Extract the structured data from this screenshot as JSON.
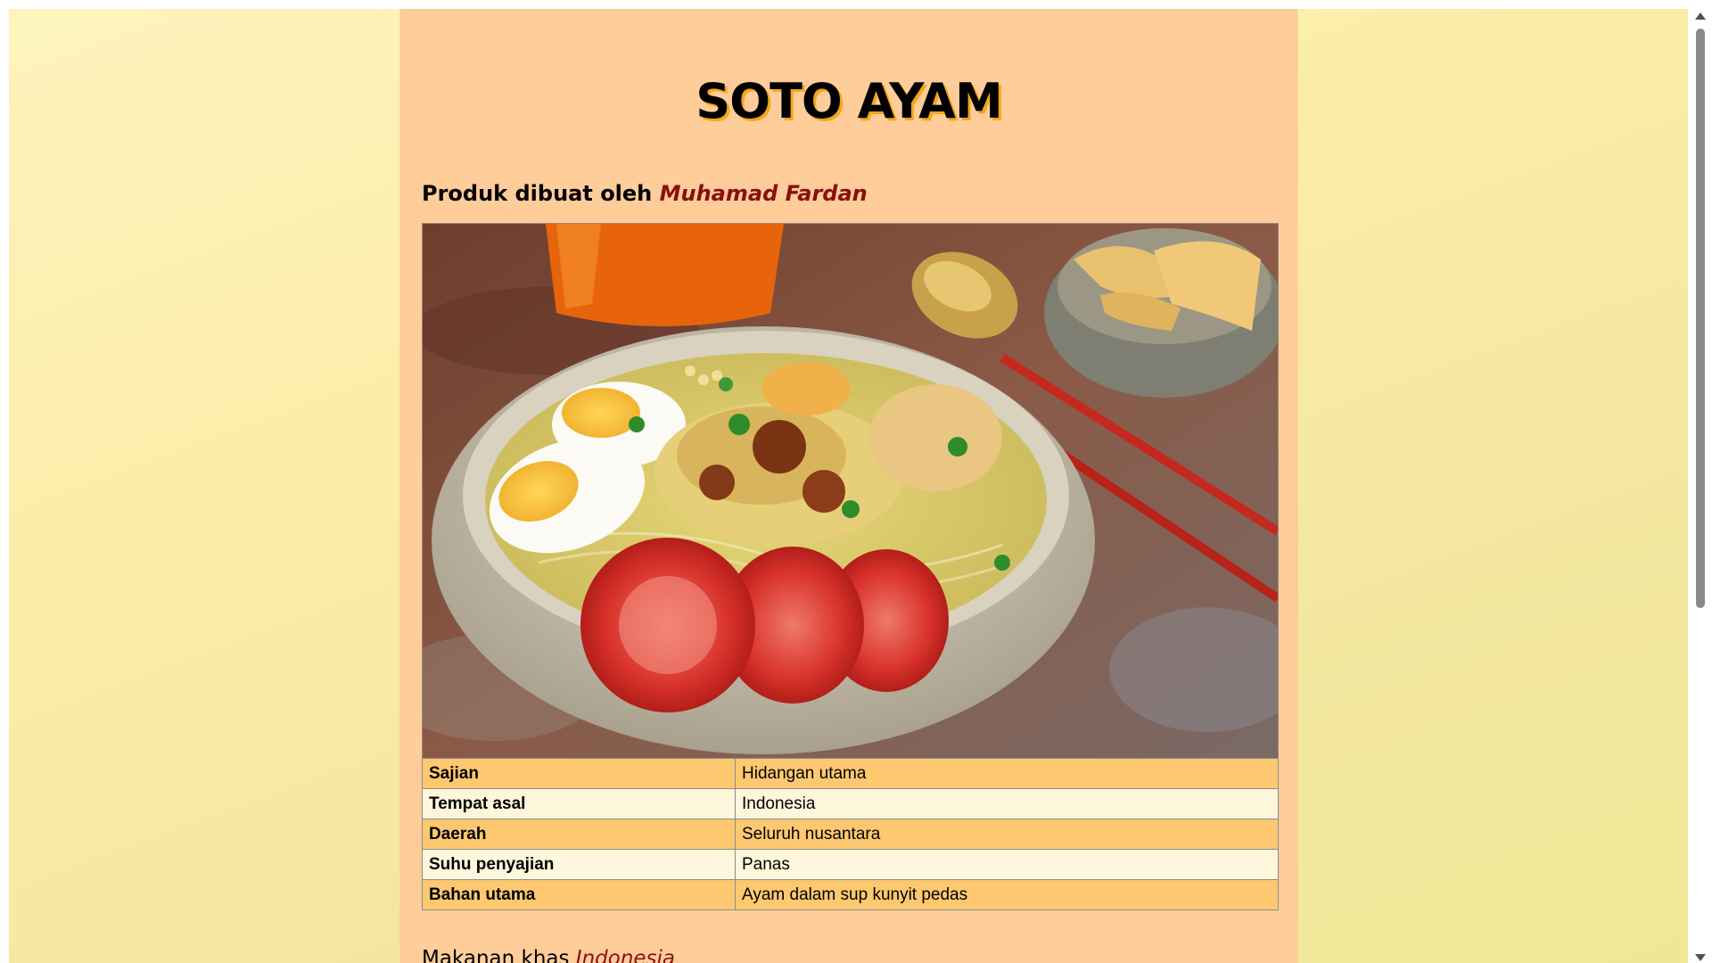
{
  "page": {
    "title": "SOTO AYAM",
    "author_prefix": "Produk dibuat oleh ",
    "author_name": "Muhamad Fardan"
  },
  "image": {
    "description_icon": "food-photo"
  },
  "info_table": {
    "rows": [
      {
        "label": "Sajian",
        "value": "Hidangan utama"
      },
      {
        "label": "Tempat asal",
        "value": "Indonesia"
      },
      {
        "label": "Daerah",
        "value": "Seluruh nusantara"
      },
      {
        "label": "Suhu penyajian",
        "value": "Panas"
      },
      {
        "label": "Bahan utama",
        "value": "Ayam dalam sup kunyit pedas"
      }
    ]
  },
  "footer": {
    "prefix": "Makanan khas ",
    "country": "Indonesia"
  },
  "colors": {
    "card_bg": "#fecd99",
    "row_odd": "#fdc870",
    "row_even": "#fef7db",
    "accent_name": "#8a0f0f",
    "title_shadow": "#f3a61a"
  }
}
